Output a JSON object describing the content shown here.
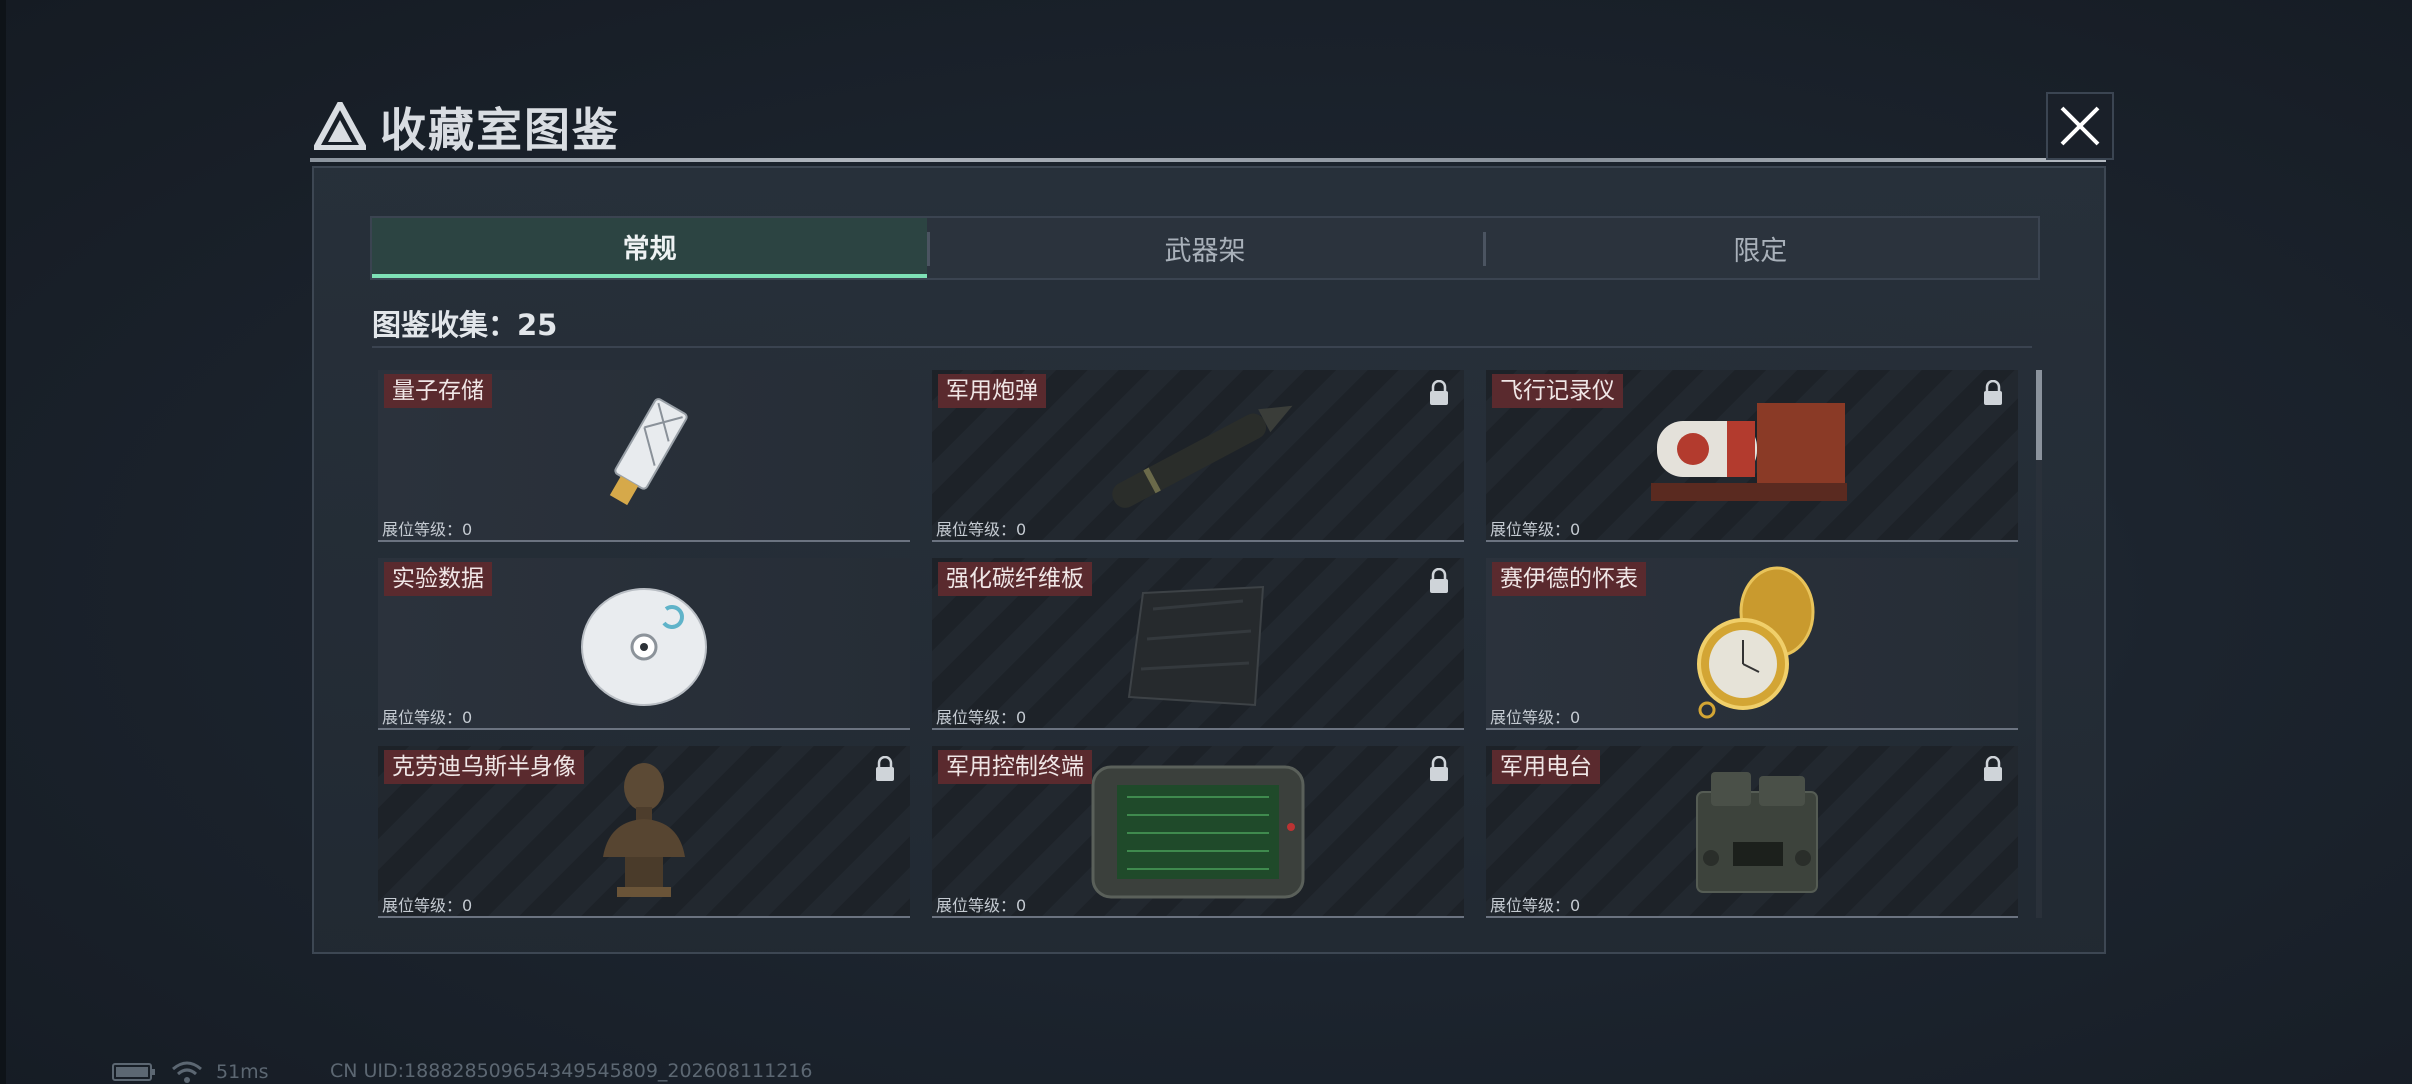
{
  "window": {
    "title": "收藏室图鉴"
  },
  "tabs": [
    {
      "label": "常规",
      "active": true
    },
    {
      "label": "武器架",
      "active": false
    },
    {
      "label": "限定",
      "active": false
    }
  ],
  "collection": {
    "label": "图鉴收集：25"
  },
  "cards": [
    {
      "name": "量子存储",
      "level": "展位等级：0",
      "locked": false,
      "icon": "usb-drive-icon"
    },
    {
      "name": "军用炮弹",
      "level": "展位等级：0",
      "locked": true,
      "icon": "artillery-shell-icon"
    },
    {
      "name": "飞行记录仪",
      "level": "展位等级：0",
      "locked": true,
      "icon": "flight-recorder-icon"
    },
    {
      "name": "实验数据",
      "level": "展位等级：0",
      "locked": false,
      "icon": "disc-icon"
    },
    {
      "name": "强化碳纤维板",
      "level": "展位等级：0",
      "locked": true,
      "icon": "carbon-plate-icon"
    },
    {
      "name": "赛伊德的怀表",
      "level": "展位等级：0",
      "locked": false,
      "icon": "pocket-watch-icon"
    },
    {
      "name": "克劳迪乌斯半身像",
      "level": "展位等级：0",
      "locked": true,
      "icon": "bust-icon"
    },
    {
      "name": "军用控制终端",
      "level": "展位等级：0",
      "locked": true,
      "icon": "control-terminal-icon"
    },
    {
      "name": "军用电台",
      "level": "展位等级：0",
      "locked": true,
      "icon": "radio-icon"
    }
  ],
  "status": {
    "ping": "51ms",
    "uid": "CN UID:18882850965434954580­9_202608111216"
  },
  "colors": {
    "accent": "#7ee1b6",
    "label_bg": "#5a2a2e"
  }
}
